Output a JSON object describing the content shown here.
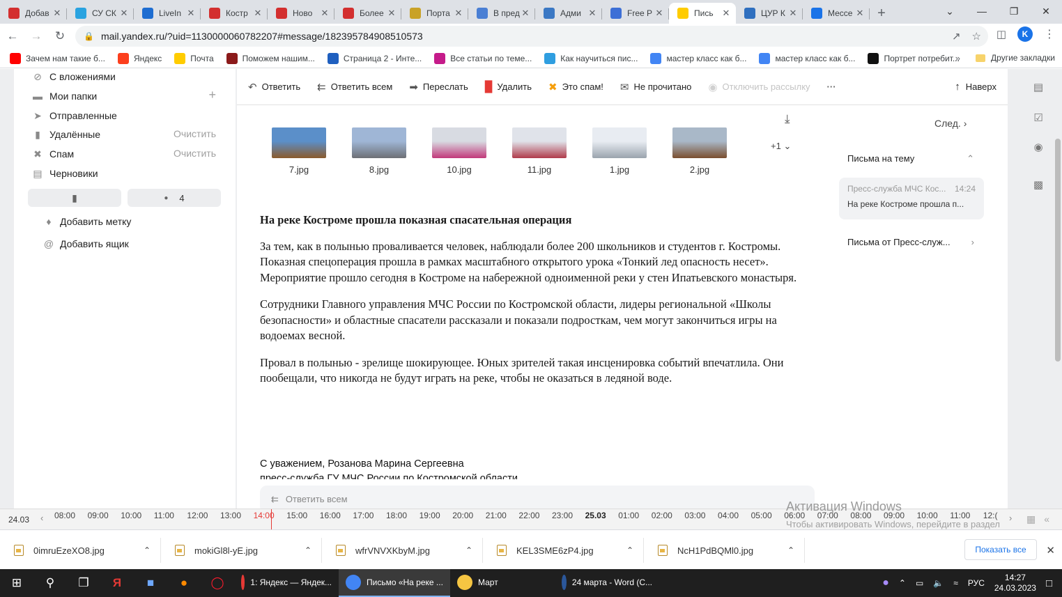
{
  "browser": {
    "tabs": [
      {
        "title": "Добав",
        "icon": "news-icon",
        "color": "#d32f2f",
        "active": false
      },
      {
        "title": "СУ СК",
        "icon": "telegram-icon",
        "color": "#2aa3e0",
        "active": false
      },
      {
        "title": "LiveIn",
        "icon": "liveinternet-icon",
        "color": "#1e6dd1",
        "active": false
      },
      {
        "title": "Костр",
        "icon": "news-icon",
        "color": "#d32f2f",
        "active": false
      },
      {
        "title": "Ново",
        "icon": "news-icon",
        "color": "#d32f2f",
        "active": false
      },
      {
        "title": "Более",
        "icon": "news-icon",
        "color": "#d32f2f",
        "active": false
      },
      {
        "title": "Порта",
        "icon": "crown-icon",
        "color": "#c9a227",
        "active": false
      },
      {
        "title": "В пред",
        "icon": "site-icon",
        "color": "#4a7fd4",
        "active": false
      },
      {
        "title": "Адми",
        "icon": "site-icon",
        "color": "#3b78c4",
        "active": false
      },
      {
        "title": "Free P",
        "icon": "star-icon",
        "color": "#3d6fd6",
        "active": false
      },
      {
        "title": "Пись",
        "icon": "mail-icon",
        "color": "#ffcc00",
        "active": true
      },
      {
        "title": "ЦУР К",
        "icon": "vk-icon",
        "color": "#2f6fbf",
        "active": false
      },
      {
        "title": "Мессе",
        "icon": "messenger-icon",
        "color": "#1a73e8",
        "active": false
      }
    ],
    "url": "mail.yandex.ru/?uid=1130000060782207#message/182395784908510573",
    "profile_initial": "K",
    "bookmarks": [
      {
        "label": "Зачем нам такие б...",
        "color": "#ff0000",
        "icon": "youtube-icon"
      },
      {
        "label": "Яндекс",
        "color": "#fc3f1d",
        "icon": "yandex-icon"
      },
      {
        "label": "Почта",
        "color": "#ffcc00",
        "icon": "mail-icon"
      },
      {
        "label": "Поможем нашим...",
        "color": "#8b1a1a",
        "icon": "site-icon"
      },
      {
        "label": "Страница 2 - Инте...",
        "color": "#1f5fbf",
        "icon": "site-icon"
      },
      {
        "label": "Все статьи по теме...",
        "color": "#c51b8a",
        "icon": "site-icon"
      },
      {
        "label": "Как научиться пис...",
        "color": "#2f9ee0",
        "icon": "site-icon"
      },
      {
        "label": "мастер класс как б...",
        "color": "#4285f4",
        "icon": "google-icon"
      },
      {
        "label": "мастер класс как б...",
        "color": "#4285f4",
        "icon": "google-icon"
      },
      {
        "label": "Портрет потребит...",
        "color": "#111111",
        "icon": "site-icon"
      }
    ],
    "bookmarks_more": "»",
    "other_bookmarks": "Другие закладки"
  },
  "sidebar": {
    "folders": [
      {
        "label": "С вложениями",
        "icon": "attachment-icon",
        "action": ""
      },
      {
        "label": "Мои папки",
        "icon": "folder-icon",
        "action": "+"
      },
      {
        "label": "Отправленные",
        "icon": "send-icon",
        "action": ""
      },
      {
        "label": "Удалённые",
        "icon": "trash-icon",
        "action": "Очистить"
      },
      {
        "label": "Спам",
        "icon": "spam-icon",
        "action": "Очистить"
      },
      {
        "label": "Черновики",
        "icon": "draft-icon",
        "action": ""
      }
    ],
    "unread_count": "4",
    "add_label": "Добавить метку",
    "add_mailbox": "Добавить ящик"
  },
  "toolbar": {
    "reply": "Ответить",
    "reply_all": "Ответить всем",
    "forward": "Переслать",
    "delete": "Удалить",
    "spam": "Это спам!",
    "unread": "Не прочитано",
    "unsubscribe": "Отключить рассылку",
    "more": "···",
    "top": "Наверх"
  },
  "attachments": [
    {
      "name": "7.jpg",
      "c1": "#5b8fc9",
      "c2": "#8b5a2b"
    },
    {
      "name": "8.jpg",
      "c1": "#9fb6d6",
      "c2": "#6d6f75"
    },
    {
      "name": "10.jpg",
      "c1": "#d8dbe2",
      "c2": "#c2387a"
    },
    {
      "name": "11.jpg",
      "c1": "#e0e3ea",
      "c2": "#b03a4a"
    },
    {
      "name": "1.jpg",
      "c1": "#e8ecf2",
      "c2": "#9aa3ad"
    },
    {
      "name": "2.jpg",
      "c1": "#a9b8c8",
      "c2": "#7a4e2e"
    }
  ],
  "attachments_more": "+1",
  "mail": {
    "title": "На реке Костроме прошла показная спасательная операция",
    "paragraphs": [
      "За тем, как в полынью проваливается человек, наблюдали более 200 школьников и студентов г. Костромы. Показная спецоперация прошла в рамках масштабного открытого урока «Тонкий лед опасность несет». Мероприятие прошло сегодня в Костроме на набережной одноименной реки у стен Ипатьевского монастыря.",
      "Сотрудники Главного управления МЧС России по Костромской области, лидеры региональной «Школы безопасности»  и областные спасатели рассказали и показали подросткам, чем могут закончиться игры на водоемах весной.",
      "Провал в полынью - зрелище шокирующее. Юных зрителей такая инсценировка событий впечатлила. Они пообещали, что никогда не будут играть на реке, чтобы не оказаться в ледяной воде."
    ],
    "signature_line1": "С уважением, Розанова Марина Сергеевна",
    "signature_line2": "пресс-служба ГУ МЧС России по Костромской области",
    "reply_all_bar": "Ответить всем"
  },
  "thread": {
    "next": "След.",
    "header": "Письма на тему",
    "card_sender": "Пресс-служба МЧС Кос...",
    "card_time": "14:24",
    "card_subject": "На реке Костроме прошла п...",
    "from_link": "Письма от Пресс-служ..."
  },
  "timeline": {
    "date": "24.03",
    "ticks": [
      "08:00",
      "09:00",
      "10:00",
      "11:00",
      "12:00",
      "13:00",
      "14:00",
      "15:00",
      "16:00",
      "17:00",
      "18:00",
      "19:00",
      "20:00",
      "21:00",
      "22:00",
      "23:00",
      "25.03",
      "01:00",
      "02:00",
      "03:00",
      "04:00",
      "05:00",
      "06:00",
      "07:00",
      "08:00",
      "09:00",
      "10:00",
      "11:00",
      "12:("
    ],
    "current": "14:00"
  },
  "windows_activation": {
    "title": "Активация Windows",
    "subtitle": "Чтобы активировать Windows, перейдите в раздел \"Параметры\"."
  },
  "downloads": {
    "files": [
      "0imruEzeXO8.jpg",
      "mokiGl8l-yE.jpg",
      "wfrVNVXKbyM.jpg",
      "KEL3SME6zP4.jpg",
      "NcH1PdBQMl0.jpg"
    ],
    "show_all": "Показать все"
  },
  "taskbar": {
    "apps": [
      {
        "label": "1: Яндекс — Яндек...",
        "icon": "yandex-browser-icon",
        "color": "#e53935",
        "active": false
      },
      {
        "label": "Письмо «На реке ...",
        "icon": "chrome-icon",
        "color": "#4285f4",
        "active": true
      },
      {
        "label": "Март",
        "icon": "folder-icon",
        "color": "#f5c542",
        "active": false
      },
      {
        "label": "24 марта - Word (С...",
        "icon": "word-icon",
        "color": "#2b579a",
        "active": false
      }
    ],
    "lang": "РУС",
    "time": "14:27",
    "date": "24.03.2023"
  }
}
